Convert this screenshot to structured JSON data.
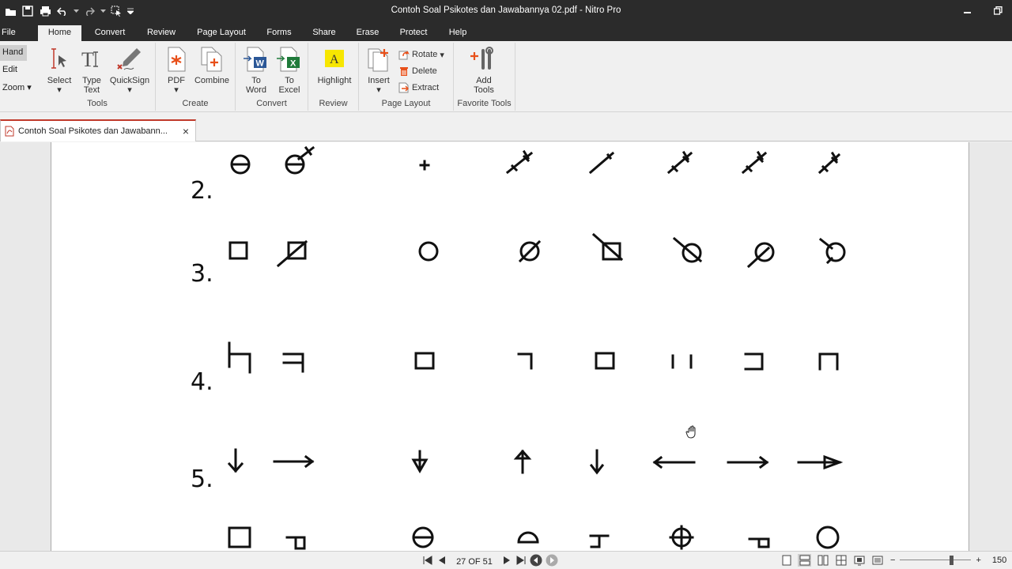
{
  "window": {
    "title": "Contoh Soal Psikotes dan Jawabannya 02.pdf - Nitro Pro"
  },
  "menu_tabs": [
    "File",
    "Home",
    "Convert",
    "Review",
    "Page Layout",
    "Forms",
    "Share",
    "Erase",
    "Protect",
    "Help"
  ],
  "active_tab": "Home",
  "modes": {
    "hand": "Hand",
    "edit": "Edit",
    "zoom": "Zoom"
  },
  "ribbon": {
    "tools": {
      "label": "Tools",
      "select": "Select",
      "type_text_1": "Type",
      "type_text_2": "Text",
      "quicksign": "QuickSign"
    },
    "create": {
      "label": "Create",
      "pdf": "PDF",
      "combine": "Combine"
    },
    "convert": {
      "label": "Convert",
      "to_word_1": "To",
      "to_word_2": "Word",
      "to_excel_1": "To",
      "to_excel_2": "Excel"
    },
    "review": {
      "label": "Review",
      "highlight": "Highlight"
    },
    "page_layout": {
      "label": "Page Layout",
      "insert": "Insert",
      "rotate": "Rotate",
      "delete": "Delete",
      "extract": "Extract"
    },
    "favorite": {
      "label": "Favorite Tools",
      "add_tools_1": "Add",
      "add_tools_2": "Tools"
    }
  },
  "document_tab": {
    "title": "Contoh Soal Psikotes dan Jawabann...",
    "close": "×"
  },
  "page_content": {
    "questions": [
      "2.",
      "3.",
      "4.",
      "5."
    ]
  },
  "status": {
    "page_indicator": "27 OF 51",
    "zoom": "150"
  },
  "colors": {
    "titlebar": "#2b2b2b",
    "accent_red": "#c0392b",
    "highlight_yellow": "#f7e600",
    "word_blue": "#2b5797",
    "excel_green": "#1f7a3a"
  }
}
